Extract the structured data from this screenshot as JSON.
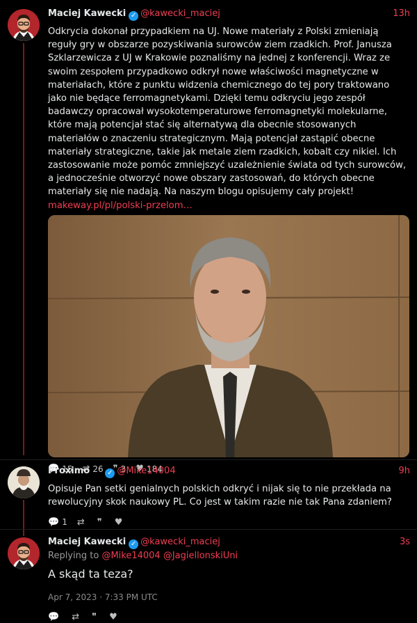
{
  "tweets": [
    {
      "name": "Maciej Kawecki",
      "handle": "@kawecki_maciej",
      "time": "13h",
      "text": "Odkrycia dokonał przypadkiem na UJ. Nowe materiały z Polski zmieniają reguły gry w obszarze pozyskiwania surowców ziem rzadkich. Prof. Janusza Szklarzewicza z UJ w Krakowie poznaliśmy na jednej z konferencji. Wraz ze swoim zespołem przypadkowo odkrył nowe właściwości magnetyczne w materiałach, które z punktu widzenia chemicznego do tej pory traktowano jako nie będące ferromagnetykami. Dzięki temu odkryciu jego zespół badawczy opracował wysokotemperaturowe ferromagnetyki molekularne, które mają potencjał stać się alternatywą dla obecnie stosowanych materiałów o znaczeniu strategicznym. Mają potencjał zastąpić obecne materiały strategiczne, takie jak metale ziem rzadkich, kobalt czy nikiel. Ich zastosowanie może pomóc zmniejszyć uzależnienie świata od tych surowców, a jednocześnie otworzyć nowe obszary zastosowań, do których obecne materiały się nie nadają. Na naszym blogu opisujemy cały projekt!",
      "link": "makeway.pl/pl/polski-przelom…",
      "stats": {
        "replies": "15",
        "retweets": "26",
        "quotes": "3",
        "likes": "184"
      }
    },
    {
      "name": "Proximo",
      "handle": "@Mike14004",
      "time": "9h",
      "text": "Opisuje Pan setki genialnych polskich odkryć i nijak się to nie przekłada na rewolucyjny skok naukowy PL. Co jest w takim razie nie tak Pana zdaniem?",
      "stats": {
        "replies": "1",
        "retweets": "",
        "quotes": "",
        "likes": ""
      }
    },
    {
      "name": "Maciej Kawecki",
      "handle": "@kawecki_maciej",
      "time": "3s",
      "replying_prefix": "Replying to",
      "replying_to": "@Mike14004 @JagiellonskiUni",
      "text": "A skąd ta teza?",
      "date": "Apr 7, 2023 · 7:33 PM UTC",
      "stats": {
        "replies": "",
        "retweets": "",
        "quotes": "",
        "likes": ""
      }
    }
  ],
  "icons": {
    "reply": "comment-icon",
    "retweet": "retweet-icon",
    "quote": "quote-icon",
    "like": "heart-icon",
    "verified": "verified-icon"
  },
  "colors": {
    "accent": "#ef3e52",
    "verified": "#1d9bf0",
    "thread": "#7a1822"
  }
}
